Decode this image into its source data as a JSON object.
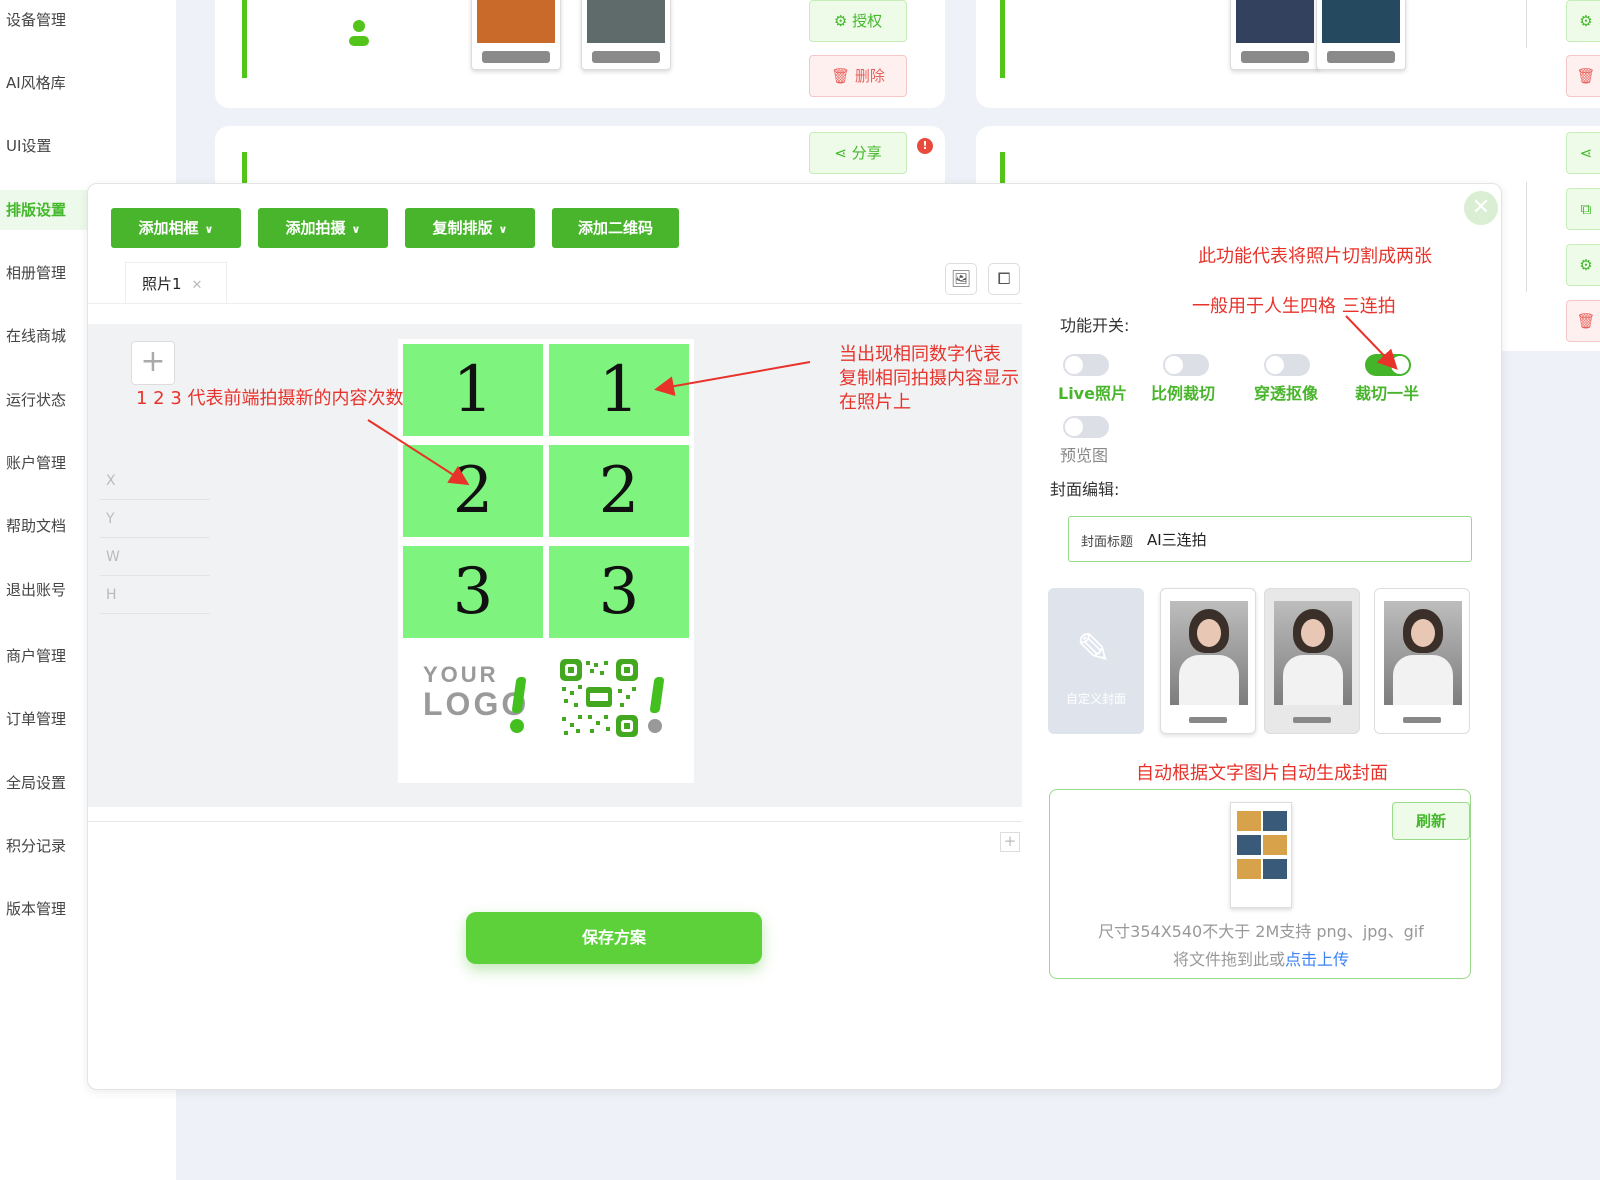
{
  "sidebar": {
    "items": [
      {
        "label": "设备管理",
        "active": false
      },
      {
        "label": "AI风格库",
        "active": false
      },
      {
        "label": "UI设置",
        "active": false
      },
      {
        "label": "排版设置",
        "active": true
      },
      {
        "label": "相册管理",
        "active": false
      },
      {
        "label": "在线商城",
        "active": false
      },
      {
        "label": "运行状态",
        "active": false
      },
      {
        "label": "账户管理",
        "active": false
      },
      {
        "label": "帮助文档",
        "active": false
      },
      {
        "label": "退出账号",
        "active": false
      },
      {
        "label": "商户管理",
        "active": false
      },
      {
        "label": "订单管理",
        "active": false
      },
      {
        "label": "全局设置",
        "active": false
      },
      {
        "label": "积分记录",
        "active": false
      },
      {
        "label": "版本管理",
        "active": false
      }
    ]
  },
  "background": {
    "authorize_label": "授权",
    "delete_label": "删除",
    "share_label": "分享",
    "alert_badge": "!"
  },
  "modal": {
    "toolbar": {
      "add_frame": "添加相框",
      "add_shot": "添加拍摄",
      "copy_layout": "复制排版",
      "add_qrcode": "添加二维码"
    },
    "tab": {
      "label": "照片1"
    },
    "coords": [
      "X",
      "Y",
      "W",
      "H"
    ],
    "grid_cells": [
      "1",
      "1",
      "2",
      "2",
      "3",
      "3"
    ],
    "logo": {
      "line1": "YOUR",
      "line2": "LOGO"
    },
    "save_label": "保存方案"
  },
  "settings": {
    "feature_label": "功能开关:",
    "toggles": [
      {
        "label": "Live照片",
        "on": false
      },
      {
        "label": "比例裁切",
        "on": false
      },
      {
        "label": "穿透抠像",
        "on": false
      },
      {
        "label": "裁切一半",
        "on": true
      },
      {
        "label": "预览图",
        "on": false
      }
    ],
    "cover_label": "封面编辑:",
    "cover_title_label": "封面标题",
    "cover_title_value": "AI三连拍",
    "custom_cover_label": "自定义封面",
    "refresh_label": "刷新",
    "upload_hint_line1": "尺寸354X540不大于 2M支持 png、jpg、gif",
    "upload_hint_line2_prefix": "将文件拖到此或",
    "upload_hint_link": "点击上传"
  },
  "annotations": {
    "split_note": "此功能代表将照片切割成两张",
    "usage_note": "一般用于人生四格  三连拍",
    "copy_note_1": "当出现相同数字代表",
    "copy_note_2": "复制相同拍摄内容显示",
    "copy_note_3": "在照片上",
    "count_note": "1 2 3 代表前端拍摄新的内容次数",
    "cover_note": "自动根据文字图片自动生成封面"
  },
  "colors": {
    "accent": "#49b52c",
    "cell_green": "#7ef47e",
    "annotation_red": "#e8332b"
  }
}
